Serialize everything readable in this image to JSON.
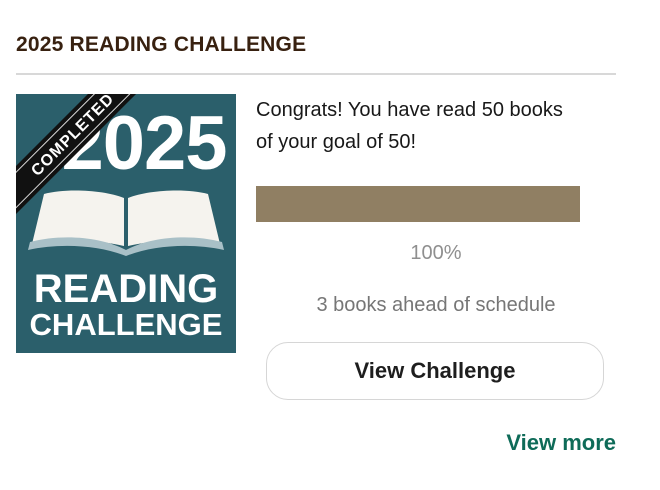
{
  "widget": {
    "title": "2025 READING CHALLENGE"
  },
  "badge": {
    "year": "2025",
    "ribbon": "COMPLETED",
    "line1": "READING",
    "line2": "CHALLENGE",
    "icon": "open-book-icon",
    "colors": {
      "background": "#2b5f6b",
      "ribbon": "#111111",
      "text": "#ffffff"
    }
  },
  "progress": {
    "message": "Congrats! You have read 50 books of your goal of 50!",
    "books_read": 50,
    "goal": 50,
    "fraction": 1.0,
    "percent_text": "100%",
    "schedule_text": "3 books ahead of schedule",
    "bar_color": "#907f63"
  },
  "actions": {
    "view_challenge": "View Challenge",
    "view_more": "View more",
    "link_color": "#0e6b58"
  }
}
